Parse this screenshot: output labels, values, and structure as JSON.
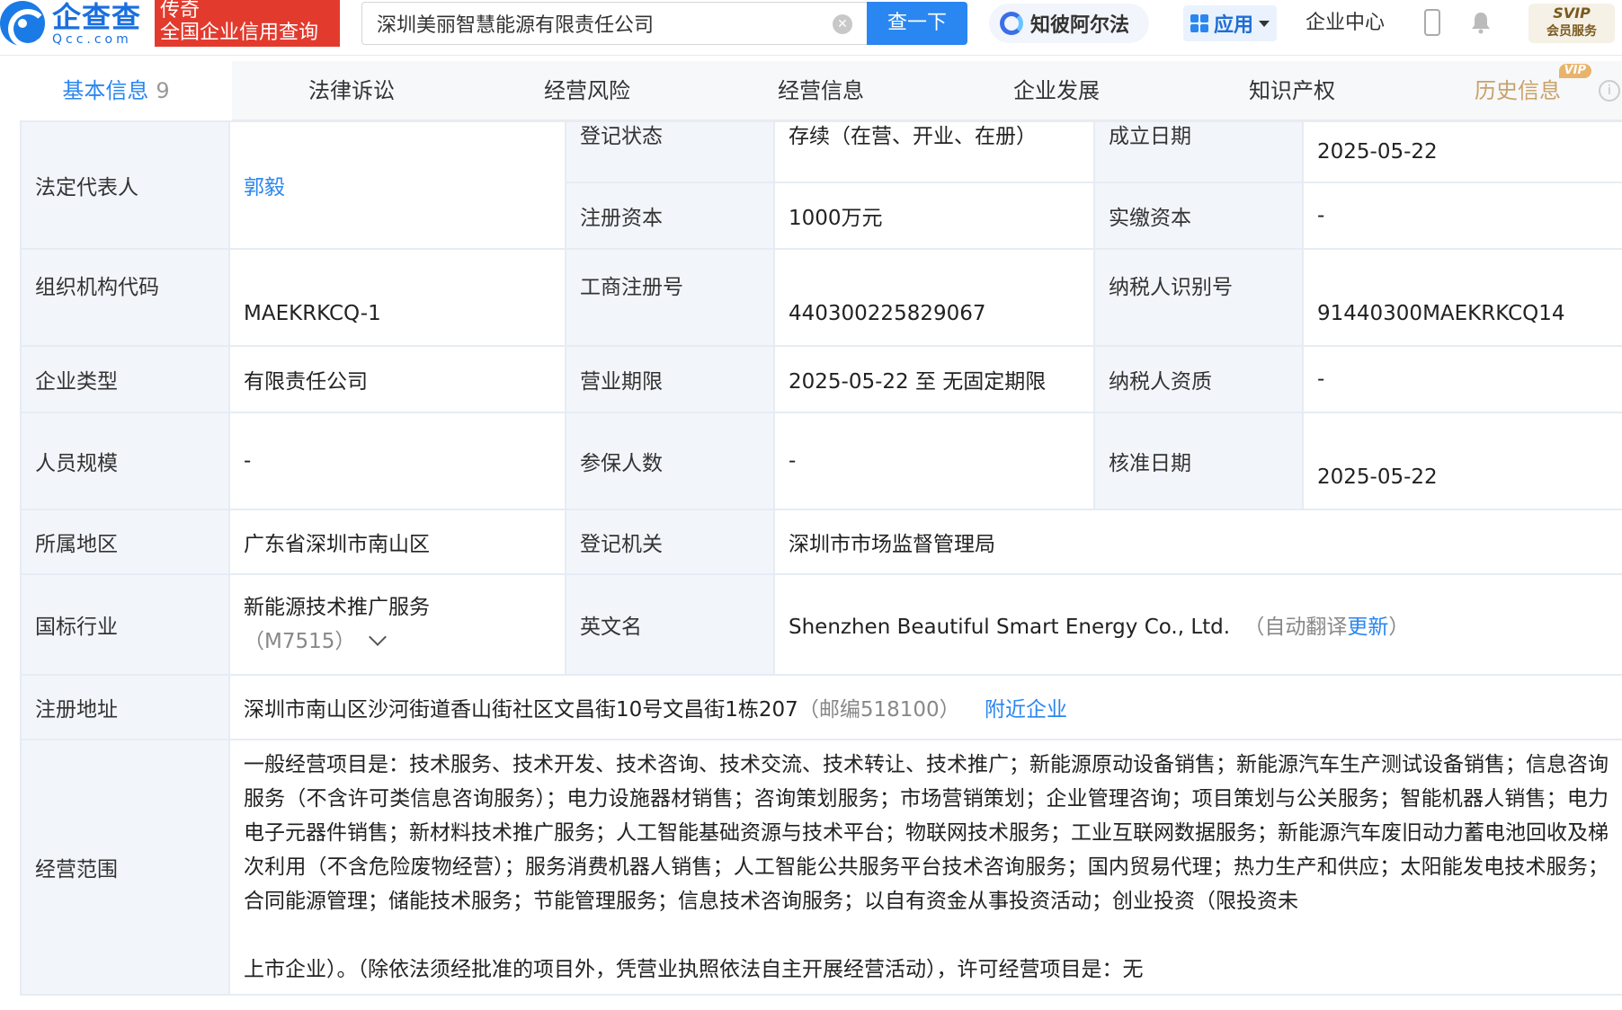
{
  "header": {
    "logo_cn": "企查查",
    "logo_en": "Qcc.com",
    "badge_line1": "传奇",
    "badge_line2": "全国企业信用查询",
    "search_value": "深圳美丽智慧能源有限责任公司",
    "search_button": "查一下",
    "zhibi_label": "知彼阿尔法",
    "apps_label": "应用",
    "enterprise_center": "企业中心",
    "svip_line1": "SVIP",
    "svip_line2": "会员服务"
  },
  "tabs": [
    {
      "label": "基本信息",
      "count": "9"
    },
    {
      "label": "法律诉讼"
    },
    {
      "label": "经营风险"
    },
    {
      "label": "经营信息"
    },
    {
      "label": "企业发展"
    },
    {
      "label": "知识产权"
    },
    {
      "label": "历史信息",
      "tag": "VIP"
    }
  ],
  "info": {
    "legal_rep": {
      "label": "法定代表人",
      "value": "郭毅"
    },
    "reg_status": {
      "label": "登记状态",
      "value": "存续（在营、开业、在册）"
    },
    "est_date": {
      "label": "成立日期",
      "value": "2025-05-22"
    },
    "reg_capital": {
      "label": "注册资本",
      "value": "1000万元"
    },
    "paid_capital": {
      "label": "实缴资本",
      "value": "-"
    },
    "org_code": {
      "label": "组织机构代码",
      "value": "MAEKRKCQ-1"
    },
    "biz_reg_no": {
      "label": "工商注册号",
      "value": "440300225829067"
    },
    "taxpayer_id": {
      "label": "纳税人识别号",
      "value": "91440300MAEKRKCQ14"
    },
    "ent_type": {
      "label": "企业类型",
      "value": "有限责任公司"
    },
    "biz_term": {
      "label": "营业期限",
      "value": "2025-05-22 至 无固定期限"
    },
    "taxpayer_qual": {
      "label": "纳税人资质",
      "value": "-"
    },
    "staff_size": {
      "label": "人员规模",
      "value": "-"
    },
    "insured": {
      "label": "参保人数",
      "value": "-"
    },
    "approval_date": {
      "label": "核准日期",
      "value": "2025-05-22"
    },
    "region": {
      "label": "所属地区",
      "value": "广东省深圳市南山区"
    },
    "reg_authority": {
      "label": "登记机关",
      "value": "深圳市市场监督管理局"
    },
    "industry": {
      "label": "国标行业",
      "value": "新能源技术推广服务",
      "code": "（M7515）"
    },
    "english_name": {
      "label": "英文名",
      "value": "Shenzhen Beautiful Smart Energy Co., Ltd.",
      "note_prefix": "（自动翻译",
      "note_link": "更新",
      "note_suffix": "）"
    },
    "reg_address": {
      "label": "注册地址",
      "value": "深圳市南山区沙河街道香山街社区文昌街10号文昌街1栋207",
      "postcode": "（邮编518100）",
      "nearby": "附近企业"
    },
    "biz_scope": {
      "label": "经营范围",
      "value": "一般经营项目是：技术服务、技术开发、技术咨询、技术交流、技术转让、技术推广；新能源原动设备销售；新能源汽车生产测试设备销售；信息咨询服务（不含许可类信息咨询服务）；电力设施器材销售；咨询策划服务；市场营销策划；企业管理咨询；项目策划与公关服务；智能机器人销售；电力电子元器件销售；新材料技术推广服务；人工智能基础资源与技术平台；物联网技术服务；工业互联网数据服务；新能源汽车废旧动力蓄电池回收及梯次利用（不含危险废物经营）；服务消费机器人销售；人工智能公共服务平台技术咨询服务；国内贸易代理；热力生产和供应；太阳能发电技术服务；合同能源管理；储能技术服务；节能管理服务；信息技术咨询服务；以自有资金从事投资活动；创业投资（限投资未",
      "value_tail": "上市企业）。（除依法须经批准的项目外，凭营业执照依法自主开展经营活动），许可经营项目是：无"
    }
  }
}
